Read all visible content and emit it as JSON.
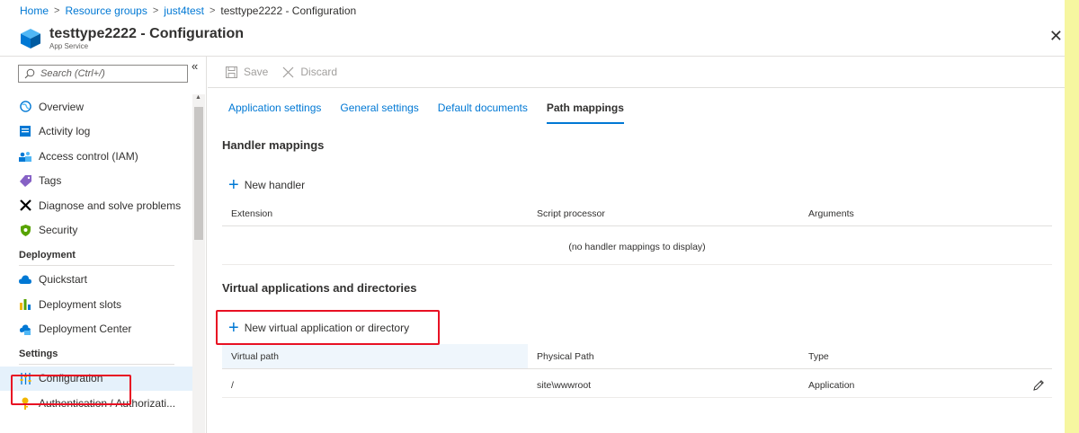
{
  "breadcrumb": {
    "home": "Home",
    "resource_groups": "Resource groups",
    "group": "just4test",
    "current": "testtype2222 - Configuration"
  },
  "header": {
    "title": "testtype2222 - Configuration",
    "subtitle": "App Service",
    "close": "✕",
    "icon": "app-service-cube-icon"
  },
  "sidebar": {
    "search_placeholder": "Search (Ctrl+/)",
    "collapse": "«",
    "items": [
      {
        "label": "Overview",
        "icon": "globe-icon",
        "color": "#0078d4"
      },
      {
        "label": "Activity log",
        "icon": "log-icon",
        "color": "#0078d4"
      },
      {
        "label": "Access control (IAM)",
        "icon": "people-icon",
        "color": "#0078d4"
      },
      {
        "label": "Tags",
        "icon": "tag-icon",
        "color": "#8661c5"
      },
      {
        "label": "Diagnose and solve problems",
        "icon": "wrench-icon",
        "color": "#000000"
      },
      {
        "label": "Security",
        "icon": "shield-icon",
        "color": "#57a300"
      }
    ],
    "section_deployment": "Deployment",
    "deployment_items": [
      {
        "label": "Quickstart",
        "icon": "cloud-icon",
        "color": "#0078d4"
      },
      {
        "label": "Deployment slots",
        "icon": "chart-icon",
        "color": "#f2b600"
      },
      {
        "label": "Deployment Center",
        "icon": "deploy-center-icon",
        "color": "#0078d4"
      }
    ],
    "section_settings": "Settings",
    "settings_items": [
      {
        "label": "Configuration",
        "icon": "sliders-icon",
        "color": "#0078d4"
      },
      {
        "label": "Authentication / Authorizati...",
        "icon": "key-icon",
        "color": "#f2b600"
      }
    ]
  },
  "toolbar": {
    "save": "Save",
    "discard": "Discard"
  },
  "tabs": [
    "Application settings",
    "General settings",
    "Default documents",
    "Path mappings"
  ],
  "handler": {
    "title": "Handler mappings",
    "add": "New handler",
    "columns": [
      "Extension",
      "Script processor",
      "Arguments"
    ],
    "empty": "(no handler mappings to display)"
  },
  "virtual": {
    "title": "Virtual applications and directories",
    "add": "New virtual application or directory",
    "columns": [
      "Virtual path",
      "Physical Path",
      "Type"
    ],
    "rows": [
      {
        "virtual_path": "/",
        "physical_path": "site\\wwwroot",
        "type": "Application"
      }
    ]
  },
  "colors": {
    "accent": "#0078d4",
    "highlight": "#e81123",
    "side_strip": "#f6f6a0"
  }
}
